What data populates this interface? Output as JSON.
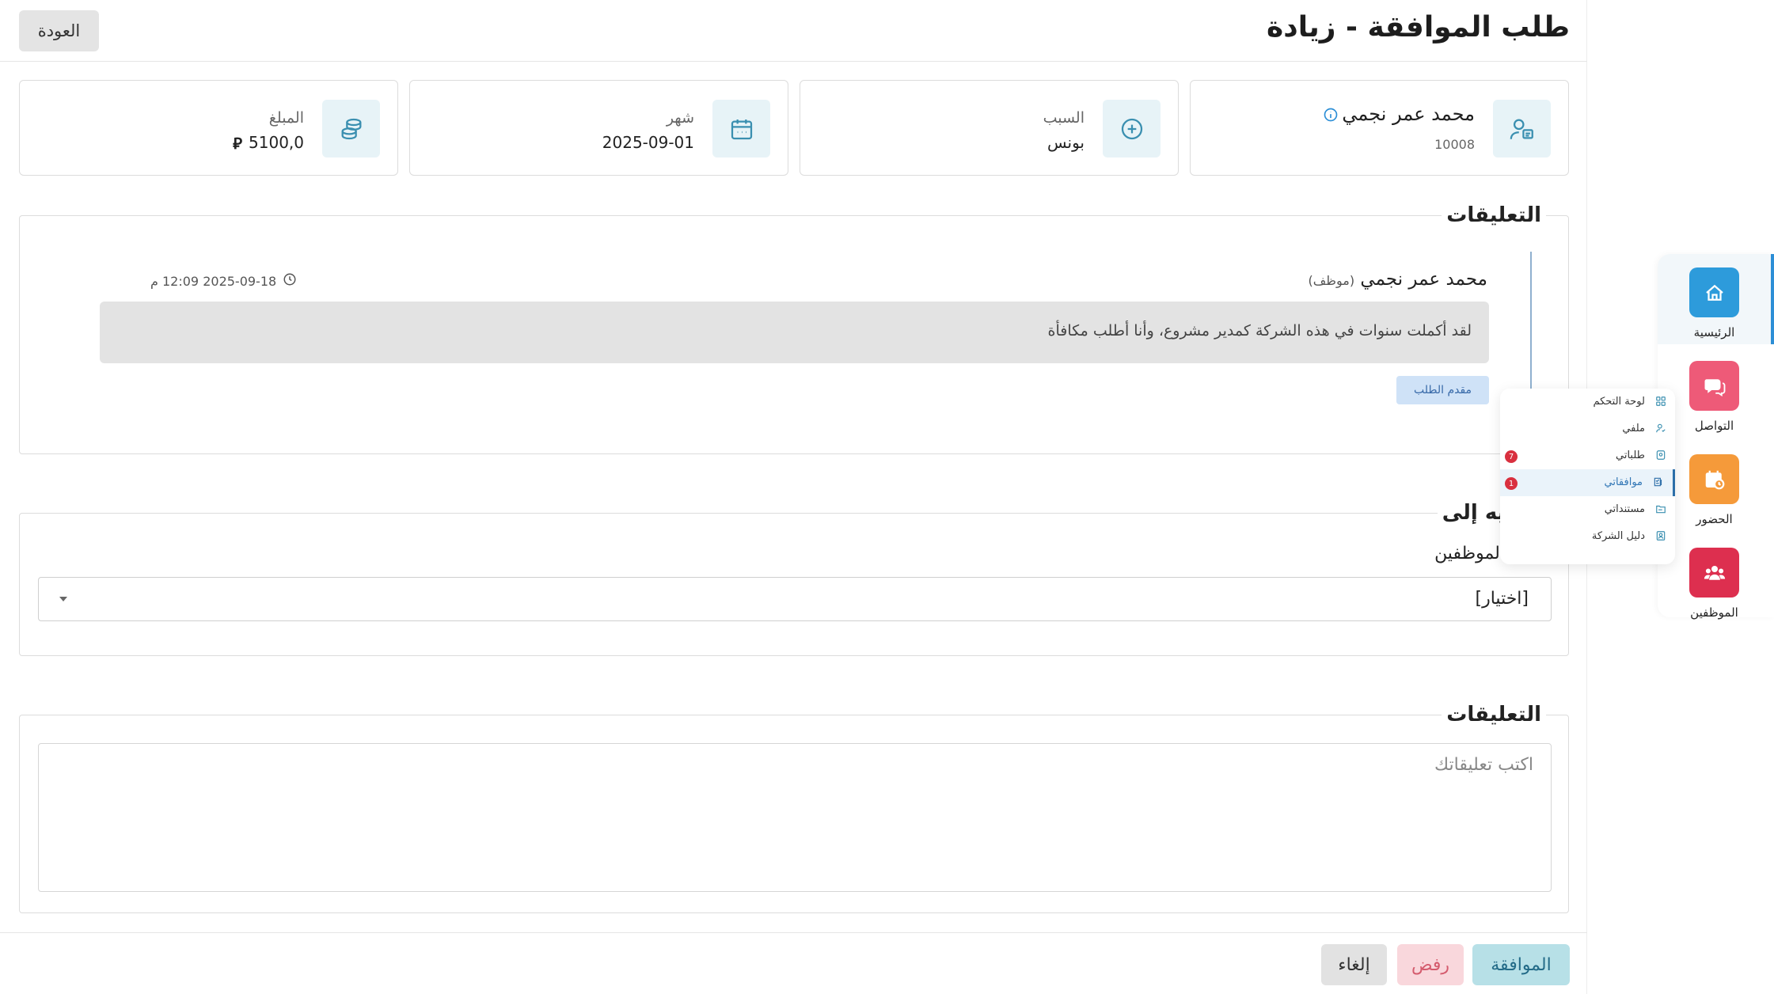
{
  "header": {
    "title": "طلب الموافقة - زيادة",
    "back_label": "العودة"
  },
  "cards": {
    "employee": {
      "name": "محمد عمر نجمي",
      "id": "10008"
    },
    "reason": {
      "label": "السبب",
      "value": "بونس"
    },
    "month": {
      "label": "شهر",
      "value": "2025-09-01"
    },
    "amount": {
      "label": "المبلغ",
      "value": "5100,0",
      "currency_symbol": "⃁"
    }
  },
  "comments_section": {
    "title": "التعليقات",
    "items": [
      {
        "author": "محمد عمر نجمي",
        "role": "(موظف)",
        "timestamp": "2025-09-18 12:09 م",
        "text": "لقد أكملت سنوات في هذه الشركة كمدير مشروع، وأنا أطلب مكافأة",
        "badge": "مقدم الطلب"
      }
    ]
  },
  "forward": {
    "title": "توجيه إلى",
    "field_label": "الموظفين",
    "select_value": "[اختيار]"
  },
  "new_comment": {
    "title": "التعليقات",
    "placeholder": "اكتب تعليقاتك"
  },
  "actions": {
    "approve": "الموافقة",
    "reject": "رفض",
    "cancel": "إلغاء"
  },
  "sidebar": {
    "items": [
      {
        "label": "الرئيسية",
        "icon": "home-icon",
        "color": "#2d9bdb",
        "active": true
      },
      {
        "label": "التواصل",
        "icon": "chat-icon",
        "color": "#ee5a78"
      },
      {
        "label": "الحضور",
        "icon": "calendar-clock-icon",
        "color": "#f59a3a"
      },
      {
        "label": "الموظفين",
        "icon": "users-icon",
        "color": "#dd2f4f"
      }
    ]
  },
  "submenu": {
    "items": [
      {
        "label": "لوحة التحكم",
        "icon": "dashboard-icon"
      },
      {
        "label": "ملفي",
        "icon": "profile-icon"
      },
      {
        "label": "طلباتي",
        "icon": "requests-icon",
        "badge": "7"
      },
      {
        "label": "موافقاتي",
        "icon": "approvals-icon",
        "badge": "1",
        "active": true
      },
      {
        "label": "مستنداتي",
        "icon": "documents-icon"
      },
      {
        "label": "دليل الشركة",
        "icon": "directory-icon"
      }
    ]
  },
  "colors": {
    "accent": "#2c8ed6",
    "card_icon_bg": "#e7f3f7",
    "card_icon_fg": "#3a8fb0",
    "approve_bg": "#b7e0e7",
    "reject_bg": "#f9d7dc",
    "badge_red": "#d9303f"
  }
}
